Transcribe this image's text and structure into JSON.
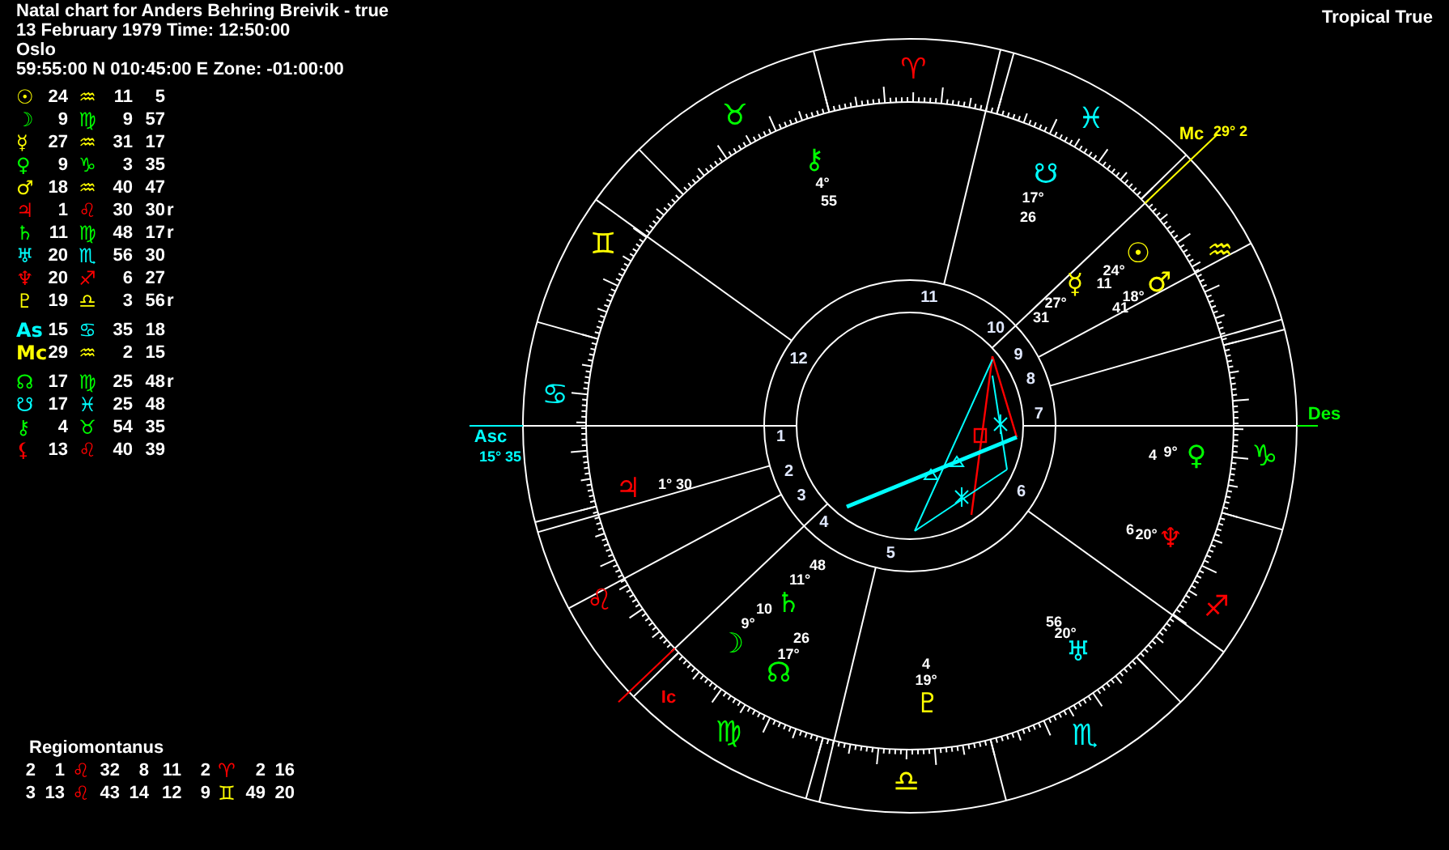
{
  "header": {
    "title": "Natal chart for Anders Behring Breivik - true",
    "date_time": "13 February 1979  Time: 12:50:00",
    "place": "Oslo",
    "coordinates": "59:55:00 N 010:45:00 E Zone: -01:00:00"
  },
  "zodiac_type": "Tropical True",
  "positions": [
    [
      {
        "glyph": "☉",
        "color": "#ffff00",
        "deg": "24",
        "sign": {
          "glyph": "♒",
          "color": "#ffff00"
        },
        "min": "11",
        "sec": "5"
      },
      {
        "glyph": "☽",
        "color": "#00ff00",
        "deg": "9",
        "sign": {
          "glyph": "♍",
          "color": "#00ff00"
        },
        "min": "9",
        "sec": "57"
      },
      {
        "glyph": "☿",
        "color": "#ffff00",
        "deg": "27",
        "sign": {
          "glyph": "♒",
          "color": "#ffff00"
        },
        "min": "31",
        "sec": "17"
      },
      {
        "glyph": "♀",
        "color": "#00ff00",
        "deg": "9",
        "sign": {
          "glyph": "♑",
          "color": "#00ff00"
        },
        "min": "3",
        "sec": "35"
      },
      {
        "glyph": "♂",
        "color": "#ffff00",
        "deg": "18",
        "sign": {
          "glyph": "♒",
          "color": "#ffff00"
        },
        "min": "40",
        "sec": "47"
      },
      {
        "glyph": "♃",
        "color": "#ff0000",
        "deg": "1",
        "sign": {
          "glyph": "♌",
          "color": "#ff0000"
        },
        "min": "30",
        "sec": "30",
        "retro": "r"
      },
      {
        "glyph": "♄",
        "color": "#00ff00",
        "deg": "11",
        "sign": {
          "glyph": "♍",
          "color": "#00ff00"
        },
        "min": "48",
        "sec": "17",
        "retro": "r"
      },
      {
        "glyph": "♅",
        "color": "#00ffff",
        "deg": "20",
        "sign": {
          "glyph": "♏",
          "color": "#00ffff"
        },
        "min": "56",
        "sec": "30"
      },
      {
        "glyph": "♆",
        "color": "#ff0000",
        "deg": "20",
        "sign": {
          "glyph": "♐",
          "color": "#ff0000"
        },
        "min": "6",
        "sec": "27"
      },
      {
        "glyph": "♇",
        "color": "#ffff00",
        "deg": "19",
        "sign": {
          "glyph": "♎",
          "color": "#ffff00"
        },
        "min": "3",
        "sec": "56",
        "retro": "r"
      }
    ],
    [
      {
        "glyph": "As",
        "color": "#00ffff",
        "deg": "15",
        "sign": {
          "glyph": "♋",
          "color": "#00ffff"
        },
        "min": "35",
        "sec": "18"
      },
      {
        "glyph": "Mc",
        "color": "#ffff00",
        "deg": "29",
        "sign": {
          "glyph": "♒",
          "color": "#ffff00"
        },
        "min": "2",
        "sec": "15"
      }
    ],
    [
      {
        "glyph": "☊",
        "color": "#00ff00",
        "deg": "17",
        "sign": {
          "glyph": "♍",
          "color": "#00ff00"
        },
        "min": "25",
        "sec": "48",
        "retro": "r"
      },
      {
        "glyph": "☋",
        "color": "#00ffff",
        "deg": "17",
        "sign": {
          "glyph": "♓",
          "color": "#00ffff"
        },
        "min": "25",
        "sec": "48"
      },
      {
        "glyph": "⚷",
        "color": "#00ff00",
        "deg": "4",
        "sign": {
          "glyph": "♉",
          "color": "#00ff00"
        },
        "min": "54",
        "sec": "35"
      },
      {
        "glyph": "⚸",
        "color": "#ff0000",
        "deg": "13",
        "sign": {
          "glyph": "♌",
          "color": "#ff0000"
        },
        "min": "40",
        "sec": "39"
      }
    ]
  ],
  "houses": {
    "system": "Regiomontanus",
    "rows": [
      [
        {
          "house": "2",
          "deg": "1",
          "sign": {
            "glyph": "♌",
            "color": "#ff0000"
          },
          "min": "32",
          "sec": "8"
        },
        {
          "house": "11",
          "deg": "2",
          "sign": {
            "glyph": "♈",
            "color": "#ff0000"
          },
          "min": "2",
          "sec": "16"
        }
      ],
      [
        {
          "house": "3",
          "deg": "13",
          "sign": {
            "glyph": "♌",
            "color": "#ff0000"
          },
          "min": "43",
          "sec": "14"
        },
        {
          "house": "12",
          "deg": "9",
          "sign": {
            "glyph": "♊",
            "color": "#ffff00"
          },
          "min": "49",
          "sec": "20"
        }
      ]
    ]
  },
  "chart": {
    "signs": [
      {
        "glyph": "♈",
        "color": "#ff0000"
      },
      {
        "glyph": "♉",
        "color": "#00ff00"
      },
      {
        "glyph": "♊",
        "color": "#ffff00"
      },
      {
        "glyph": "♋",
        "color": "#00ffff"
      },
      {
        "glyph": "♌",
        "color": "#ff0000"
      },
      {
        "glyph": "♍",
        "color": "#00ff00"
      },
      {
        "glyph": "♎",
        "color": "#ffff00"
      },
      {
        "glyph": "♏",
        "color": "#00ffff"
      },
      {
        "glyph": "♐",
        "color": "#ff0000"
      },
      {
        "glyph": "♑",
        "color": "#00ff00"
      },
      {
        "glyph": "♒",
        "color": "#ffff00"
      },
      {
        "glyph": "♓",
        "color": "#00ffff"
      }
    ],
    "house_numbers": [
      "1",
      "2",
      "3",
      "4",
      "5",
      "6",
      "7",
      "8",
      "9",
      "10",
      "11",
      "12"
    ],
    "angles": [
      {
        "kind": "asc",
        "label": "Asc",
        "value": "15° 35",
        "color": "#00ffff"
      },
      {
        "kind": "mc",
        "label": "Mc",
        "value": "29° 2",
        "color": "#ffff00"
      },
      {
        "kind": "des",
        "label": "Des",
        "color": "#00ff00"
      },
      {
        "kind": "ic",
        "label": "Ic",
        "color": "#ff0000"
      }
    ],
    "planets": [
      {
        "glyph": "⚷",
        "color": "#00ff00",
        "labels": [
          "4°",
          "55"
        ]
      },
      {
        "glyph": "☋",
        "color": "#00ffff",
        "labels": [
          "17°",
          "26"
        ]
      },
      {
        "glyph": "☉",
        "color": "#ffff00",
        "labels": [
          "24°",
          "11"
        ]
      },
      {
        "glyph": "☿",
        "color": "#ffff00",
        "labels": [
          "27°",
          "31"
        ]
      },
      {
        "glyph": "♂",
        "color": "#ffff00",
        "labels": [
          "18°",
          "41"
        ]
      },
      {
        "glyph": "♀",
        "color": "#00ff00",
        "labels": [
          "4",
          "9°"
        ]
      },
      {
        "glyph": "♆",
        "color": "#ff0000",
        "labels": [
          "6",
          "20°"
        ]
      },
      {
        "glyph": "♅",
        "color": "#00ffff",
        "labels": [
          "56",
          "20°"
        ]
      },
      {
        "glyph": "♇",
        "color": "#ffff00",
        "labels": [
          "4",
          "19°"
        ]
      },
      {
        "glyph": "☊",
        "color": "#00ff00",
        "labels": [
          "26",
          "17°"
        ]
      },
      {
        "glyph": "☽",
        "color": "#00ff00",
        "labels": [
          "10",
          "9°"
        ]
      },
      {
        "glyph": "♄",
        "color": "#00ff00",
        "labels": [
          "48",
          "11°"
        ]
      },
      {
        "glyph": "♃",
        "color": "#ff0000",
        "labels": [
          "1° 30"
        ]
      }
    ]
  }
}
